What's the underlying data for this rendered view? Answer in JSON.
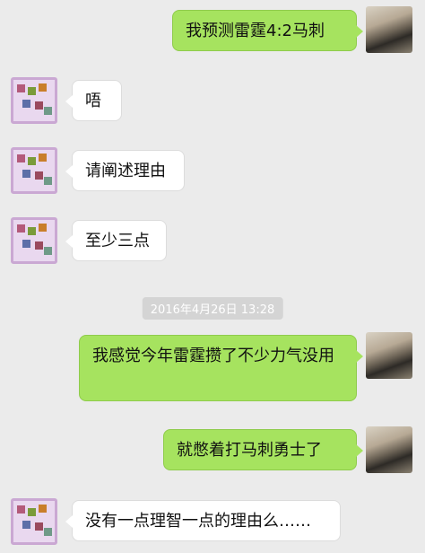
{
  "messages": [
    {
      "side": "out",
      "text": "我预测雷霆4:2马刺"
    },
    {
      "side": "in",
      "text": "唔"
    },
    {
      "side": "in",
      "text": "请阐述理由"
    },
    {
      "side": "in",
      "text": "至少三点"
    },
    {
      "side": "out",
      "text": "我感觉今年雷霆攒了不少力气没用"
    },
    {
      "side": "out",
      "text": "就憋着打马刺勇士了"
    },
    {
      "side": "in",
      "text": "没有一点理智一点的理由么……"
    }
  ],
  "timestamp": "2016年4月26日 13:28",
  "colors": {
    "background": "#ebebeb",
    "outgoing_bubble": "#a6e35f",
    "incoming_bubble": "#ffffff",
    "timestamp_badge": "#d4d4d4"
  }
}
